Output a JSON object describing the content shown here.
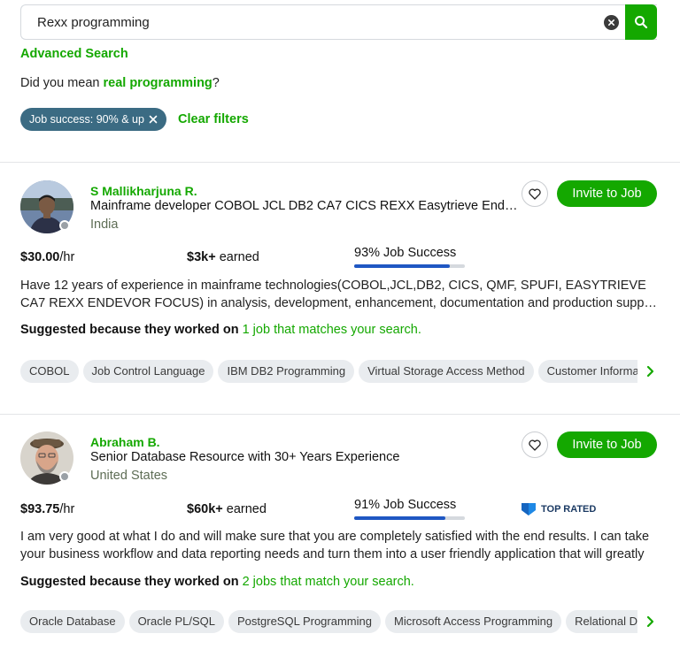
{
  "search": {
    "value": "Rexx programming",
    "placeholder": "Search"
  },
  "advanced_search": "Advanced Search",
  "did_you_mean": {
    "prefix": "Did you mean ",
    "suggestion": "real programming",
    "suffix": "?"
  },
  "filters": {
    "chip": "Job success: 90% & up",
    "clear": "Clear filters"
  },
  "colors": {
    "accent": "#14a800",
    "chip": "#3b6b83",
    "jss_bar": "#1f57c3"
  },
  "freelancers": [
    {
      "name": "S Mallikharjuna R.",
      "title": "Mainframe developer COBOL JCL DB2 CA7 CICS REXX Easytrieve Endevor",
      "location": "India",
      "invite": "Invite to Job",
      "rate": "$30.00",
      "rate_unit": "/hr",
      "earned": "$3k+",
      "earned_suffix": " earned",
      "job_success": "93% Job Success",
      "job_success_pct": 93,
      "desc_line1": "Have 12 years of experience in mainframe technologies(COBOL,JCL,DB2, CICS, QMF, SPUFI, EASYTRIEVE",
      "desc_line2": "CA7 REXX ENDEVOR FOCUS) in analysis, development, enhancement, documentation and production support",
      "suggested_prefix": "Suggested because they worked on ",
      "suggested_link": "1 job that matches your search.",
      "skills": [
        "COBOL",
        "Job Control Language",
        "IBM DB2 Programming",
        "Virtual Storage Access Method",
        "Customer Information"
      ]
    },
    {
      "name": "Abraham B.",
      "title": "Senior Database Resource with 30+ Years Experience",
      "location": "United States",
      "invite": "Invite to Job",
      "rate": "$93.75",
      "rate_unit": "/hr",
      "earned": "$60k+",
      "earned_suffix": " earned",
      "job_success": "91% Job Success",
      "job_success_pct": 91,
      "badge": "TOP RATED",
      "desc_line1": "I am very good at what I do and will make sure that you are completely satisfied with the end results. I can take",
      "desc_line2": "your business workflow and data reporting needs and turn them into a user friendly application that will greatly",
      "suggested_prefix": "Suggested because they worked on ",
      "suggested_link": "2 jobs that match your search.",
      "skills": [
        "Oracle Database",
        "Oracle PL/SQL",
        "PostgreSQL Programming",
        "Microsoft Access Programming",
        "Relational Database"
      ]
    }
  ]
}
